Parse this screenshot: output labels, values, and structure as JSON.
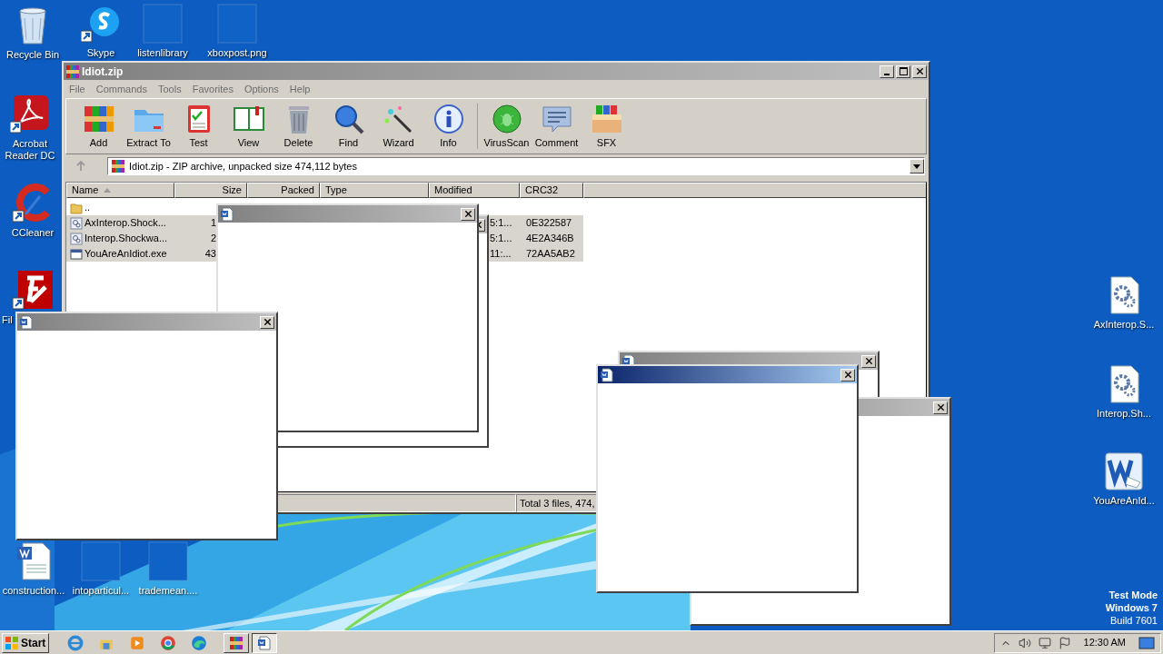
{
  "desktop_icons": [
    {
      "label": "Recycle Bin"
    },
    {
      "label": "Skype"
    },
    {
      "label": "listenlibrary"
    },
    {
      "label": "xboxpost.png"
    },
    {
      "label": "Acrobat Reader DC"
    },
    {
      "label": "CCleaner"
    },
    {
      "label": "Fil"
    },
    {
      "label": "construction..."
    },
    {
      "label": "intoparticul..."
    },
    {
      "label": "trademean...."
    },
    {
      "label": "AxInterop.S..."
    },
    {
      "label": "Interop.Sh..."
    },
    {
      "label": "YouAreAnId..."
    }
  ],
  "archive_window": {
    "title": "Idiot.zip",
    "menu": [
      "File",
      "Commands",
      "Tools",
      "Favorites",
      "Options",
      "Help"
    ],
    "toolbar": [
      {
        "label": "Add"
      },
      {
        "label": "Extract To"
      },
      {
        "label": "Test"
      },
      {
        "label": "View"
      },
      {
        "label": "Delete"
      },
      {
        "label": "Find"
      },
      {
        "label": "Wizard"
      },
      {
        "label": "Info"
      },
      {
        "label": "VirusScan"
      },
      {
        "label": "Comment"
      },
      {
        "label": "SFX"
      }
    ],
    "address": "Idiot.zip - ZIP archive, unpacked size 474,112 bytes",
    "columns": [
      "Name",
      "Size",
      "Packed",
      "Type",
      "Modified",
      "CRC32"
    ],
    "rows": [
      {
        "kind": "folder",
        "name": "..",
        "selected": false
      },
      {
        "kind": "library",
        "name": "AxInterop.Shock...",
        "size": "1",
        "modified": "5:1...",
        "crc32": "0E322587",
        "selected": true
      },
      {
        "kind": "library",
        "name": "Interop.Shockwa...",
        "size": "2",
        "modified": "5:1...",
        "crc32": "4E2A346B",
        "selected": true
      },
      {
        "kind": "program",
        "name": "YouAreAnIdiot.exe",
        "size": "43",
        "modified": "11:...",
        "crc32": "72AA5AB2",
        "selected": true
      }
    ],
    "status": "Total 3 files, 474,"
  },
  "popup_windows": [
    {
      "active": false
    },
    {
      "active": false
    },
    {
      "active": false
    },
    {
      "active": false
    },
    {
      "active": false
    },
    {
      "active": true
    }
  ],
  "watermark": [
    "Test Mode",
    "Windows 7",
    "Build 7601"
  ],
  "taskbar": {
    "start": "Start",
    "buttons": [
      {
        "selected": false
      },
      {
        "selected": true
      }
    ],
    "clock": "12:30 AM"
  }
}
